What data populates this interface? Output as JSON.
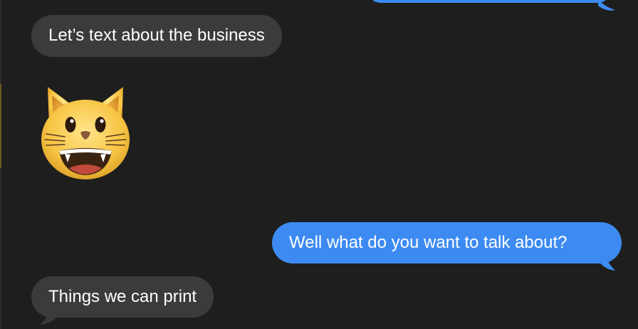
{
  "conversation": {
    "messages": [
      {
        "direction": "incoming",
        "text": "Let’s text about the business"
      },
      {
        "direction": "incoming",
        "emoji": "grinning-cat-face"
      },
      {
        "direction": "outgoing",
        "text": "Well what do you want to talk about?"
      },
      {
        "direction": "incoming",
        "text": "Things we can print"
      }
    ]
  },
  "colors": {
    "background": "#1e1e1e",
    "incoming_bubble": "#3b3b3d",
    "outgoing_bubble": "#3d8bf2",
    "message_text": "#ffffff"
  }
}
